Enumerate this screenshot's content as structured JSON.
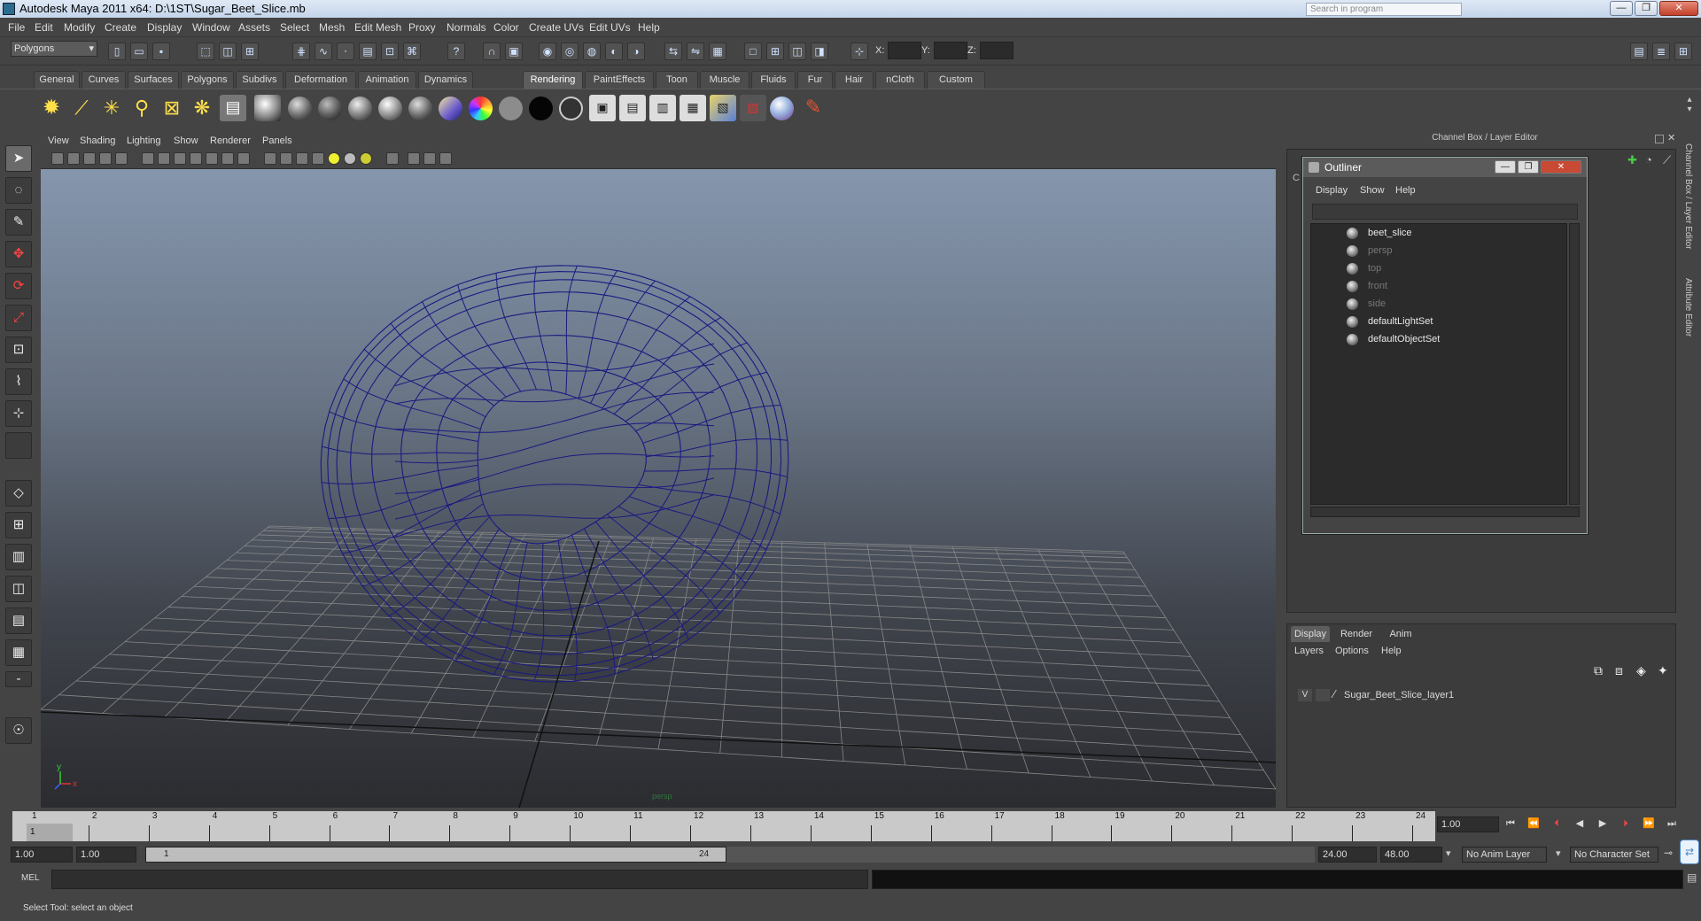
{
  "window": {
    "title": "Autodesk Maya 2011 x64: D:\\1ST\\Sugar_Beet_Slice.mb",
    "search_placeholder": "Search in program"
  },
  "menubar": [
    "File",
    "Edit",
    "Modify",
    "Create",
    "Display",
    "Window",
    "Assets",
    "Select",
    "Mesh",
    "Edit Mesh",
    "Proxy",
    "Normals",
    "Color",
    "Create UVs",
    "Edit UVs",
    "Help"
  ],
  "statusline": {
    "mode": "Polygons",
    "x_label": "X:",
    "y_label": "Y:",
    "z_label": "Z:"
  },
  "shelf_tabs": [
    "General",
    "Curves",
    "Surfaces",
    "Polygons",
    "Subdivs",
    "Deformation",
    "Animation",
    "Dynamics",
    "Rendering",
    "PaintEffects",
    "Toon",
    "Muscle",
    "Fluids",
    "Fur",
    "Hair",
    "nCloth",
    "Custom"
  ],
  "shelf_active_tab": "Rendering",
  "viewport": {
    "menu": [
      "View",
      "Shading",
      "Lighting",
      "Show",
      "Renderer",
      "Panels"
    ],
    "camera_label": "persp",
    "axis_x": "x",
    "axis_y": "y"
  },
  "channel_box": {
    "title": "Channel Box / Layer Editor",
    "side_tab_channel": "Channel Box / Layer Editor",
    "side_tab_attribute": "Attribute Editor"
  },
  "outliner": {
    "title": "Outliner",
    "menu": [
      "Display",
      "Show",
      "Help"
    ],
    "items": [
      {
        "label": "beet_slice",
        "dim": false
      },
      {
        "label": "persp",
        "dim": true
      },
      {
        "label": "top",
        "dim": true
      },
      {
        "label": "front",
        "dim": true
      },
      {
        "label": "side",
        "dim": true
      },
      {
        "label": "defaultLightSet",
        "dim": false
      },
      {
        "label": "defaultObjectSet",
        "dim": false
      }
    ]
  },
  "layer_editor": {
    "tabs": [
      "Display",
      "Render",
      "Anim"
    ],
    "active_tab": "Display",
    "menu": [
      "Layers",
      "Options",
      "Help"
    ],
    "layer": {
      "visible": "V",
      "name": "Sugar_Beet_Slice_layer1"
    }
  },
  "timeslider": {
    "ticks": [
      1,
      2,
      3,
      4,
      5,
      6,
      7,
      8,
      9,
      10,
      11,
      12,
      13,
      14,
      15,
      16,
      17,
      18,
      19,
      20,
      21,
      22,
      23,
      24
    ],
    "current_frame": "1",
    "current_time": "1.00"
  },
  "range": {
    "start": "1.00",
    "anim_start": "1.00",
    "range_start": "1",
    "range_end": "24",
    "end": "24.00",
    "anim_end": "48.00",
    "anim_layer": "No Anim Layer",
    "char_set": "No Character Set"
  },
  "command": {
    "label": "MEL"
  },
  "help_line": "Select Tool: select an object",
  "colors": {
    "wireframe": "#1a1a80",
    "accent": "#4a86c8"
  }
}
